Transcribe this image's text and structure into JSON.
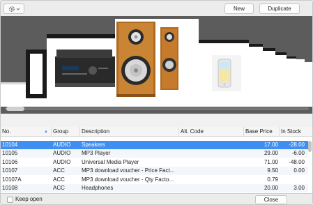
{
  "toolbar": {
    "gear_icon": "gear-icon",
    "new_label": "New",
    "duplicate_label": "Duplicate"
  },
  "carousel": {
    "items": [
      "av-receiver-image",
      "speakers-image",
      "mp3-player-image",
      "placeholder-frame"
    ],
    "selected_item": "speakers-image"
  },
  "table": {
    "headers": {
      "no": "No.",
      "group": "Group",
      "description": "Description",
      "alt_code": "Alt. Code",
      "base_price": "Base Price",
      "in_stock": "In Stock"
    },
    "rows": [
      {
        "no": "10104",
        "group": "AUDIO",
        "description": "Speakers",
        "alt_code": "",
        "base_price": "17.00",
        "in_stock": "-28.00"
      },
      {
        "no": "10105",
        "group": "AUDIO",
        "description": "MP3 Player",
        "alt_code": "",
        "base_price": "29.00",
        "in_stock": "-6.00"
      },
      {
        "no": "10106",
        "group": "AUDIO",
        "description": "Universal Media Player",
        "alt_code": "",
        "base_price": "71.00",
        "in_stock": "-48.00"
      },
      {
        "no": "10107",
        "group": "ACC",
        "description": "MP3 download voucher - Price Fact...",
        "alt_code": "",
        "base_price": "9.50",
        "in_stock": "0.00"
      },
      {
        "no": "10107A",
        "group": "ACC",
        "description": "MP3 download voucher - Qty Facto...",
        "alt_code": "",
        "base_price": "0.79",
        "in_stock": ""
      },
      {
        "no": "10108",
        "group": "ACC",
        "description": "Headphones",
        "alt_code": "",
        "base_price": "20.00",
        "in_stock": "3.00"
      }
    ]
  },
  "footer": {
    "keep_open_label": "Keep open",
    "close_label": "Close"
  },
  "colors": {
    "selection": "#3f8ff2",
    "carousel_bg": "#5c5c5c"
  }
}
